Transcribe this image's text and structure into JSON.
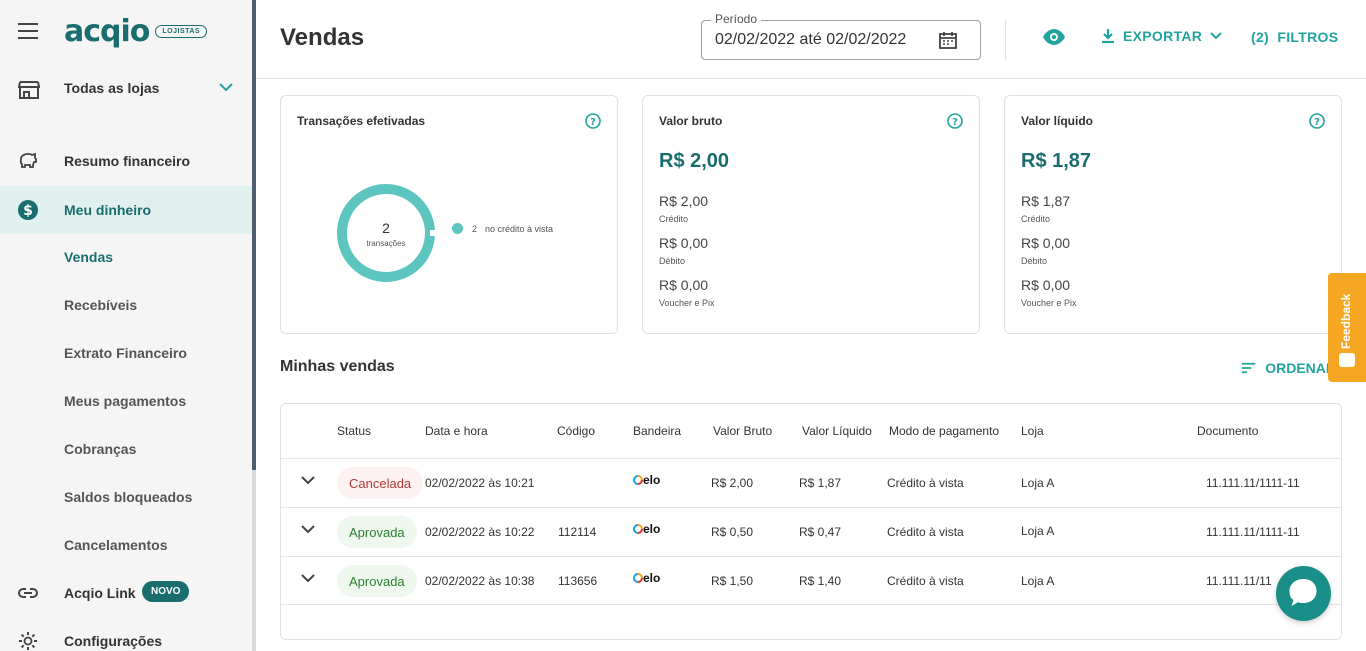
{
  "sidebar": {
    "logo": "acqio",
    "logo_badge": "LOJISTAS",
    "store_select": "Todas as lojas",
    "items": [
      {
        "label": "Resumo financeiro"
      },
      {
        "label": "Meu dinheiro"
      },
      {
        "label": "Vendas"
      },
      {
        "label": "Recebíveis"
      },
      {
        "label": "Extrato Financeiro"
      },
      {
        "label": "Meus pagamentos"
      },
      {
        "label": "Cobranças"
      },
      {
        "label": "Saldos bloqueados"
      },
      {
        "label": "Cancelamentos"
      },
      {
        "label": "Acqio Link",
        "badge": "NOVO"
      },
      {
        "label": "Configurações"
      }
    ]
  },
  "header": {
    "title": "Vendas",
    "period_legend": "Período",
    "period_value": "02/02/2022 até 02/02/2022",
    "export_label": "EXPORTAR",
    "filters_label": "(2)  FILTROS"
  },
  "cards": {
    "transactions": {
      "title": "Transações efetivadas",
      "count": "2",
      "count_label": "transações",
      "legend_count": "2",
      "legend_label": "no crédito à vista"
    },
    "gross": {
      "title": "Valor bruto",
      "total": "R$ 2,00",
      "rows": [
        {
          "amount": "R$ 2,00",
          "label": "Crédito"
        },
        {
          "amount": "R$ 0,00",
          "label": "Débito"
        },
        {
          "amount": "R$ 0,00",
          "label": "Voucher e Pix"
        }
      ]
    },
    "net": {
      "title": "Valor líquido",
      "total": "R$ 1,87",
      "rows": [
        {
          "amount": "R$ 1,87",
          "label": "Crédito"
        },
        {
          "amount": "R$ 0,00",
          "label": "Débito"
        },
        {
          "amount": "R$ 0,00",
          "label": "Voucher e Pix"
        }
      ]
    }
  },
  "sales": {
    "title": "Minhas vendas",
    "sort_label": "ORDENAR",
    "feedback_label": "Feedback",
    "columns": [
      "Status",
      "Data e hora",
      "Código",
      "Bandeira",
      "Valor Bruto",
      "Valor Líquido",
      "Modo de pagamento",
      "Loja",
      "Documento"
    ],
    "rows": [
      {
        "status": "Cancelada",
        "datetime": "02/02/2022 às 10:21",
        "code": "",
        "brand": "elo",
        "gross": "R$ 2,00",
        "net": "R$ 1,87",
        "mode": "Crédito à vista",
        "store": "Loja A",
        "document": "11.111.11/1111-11"
      },
      {
        "status": "Aprovada",
        "datetime": "02/02/2022 às 10:22",
        "code": "112114",
        "brand": "elo",
        "gross": "R$ 0,50",
        "net": "R$ 0,47",
        "mode": "Crédito à vista",
        "store": "Loja A",
        "document": "11.111.11/1111-11"
      },
      {
        "status": "Aprovada",
        "datetime": "02/02/2022 às 10:38",
        "code": "113656",
        "brand": "elo",
        "gross": "R$ 1,50",
        "net": "R$ 1,40",
        "mode": "Crédito à vista",
        "store": "Loja A",
        "document": "11.111.11/11"
      }
    ]
  },
  "colors": {
    "accent": "#22a39f",
    "brand": "#1a6d6e",
    "feedback": "#f5a623",
    "donut": "#5cc5c0"
  }
}
